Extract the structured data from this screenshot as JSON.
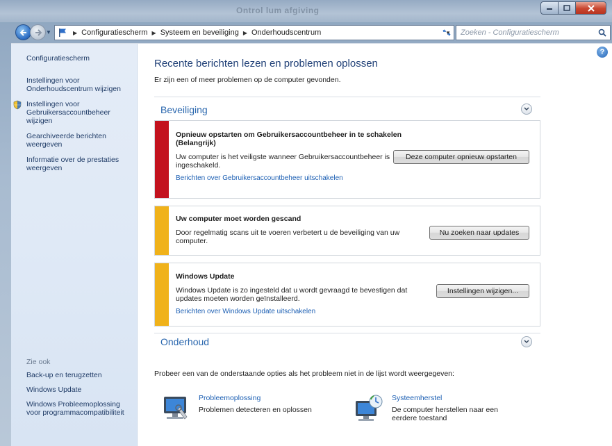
{
  "window": {
    "title": "Ontrol lum afgiving"
  },
  "nav": {
    "breadcrumb": [
      "Configuratiescherm",
      "Systeem en beveiliging",
      "Onderhoudscentrum"
    ],
    "search_placeholder": "Zoeken - Configuratiescherm"
  },
  "sidebar": {
    "home": "Configuratiescherm",
    "links": [
      "Instellingen voor Onderhoudscentrum wijzigen",
      "Instellingen voor Gebruikersaccountbeheer wijzigen",
      "Gearchiveerde berichten weergeven",
      "Informatie over de prestaties weergeven"
    ],
    "see_also_label": "Zie ook",
    "see_also": [
      "Back-up en terugzetten",
      "Windows Update",
      "Windows Probleemoplossing voor programmacompatibiliteit"
    ]
  },
  "main": {
    "heading": "Recente berichten lezen en problemen oplossen",
    "subheading": "Er zijn een of meer problemen op de computer gevonden.",
    "security": {
      "title": "Beveiliging",
      "messages": [
        {
          "title": "Opnieuw opstarten om Gebruikersaccountbeheer in te schakelen",
          "severity": "(Belangrijk)",
          "body": "Uw computer is het veiligste wanneer Gebruikersaccountbeheer is ingeschakeld.",
          "link": "Berichten over Gebruikersaccountbeheer uitschakelen",
          "button": "Deze computer opnieuw opstarten",
          "color": "#c3121e"
        },
        {
          "title": "Uw computer moet worden gescand",
          "body": "Door regelmatig scans uit te voeren verbetert u de beveiliging van uw computer.",
          "button": "Nu zoeken naar updates",
          "color": "#f0b21a"
        },
        {
          "title": "Windows Update",
          "body": "Windows Update is zo ingesteld dat u wordt gevraagd te bevestigen dat updates moeten worden geïnstalleerd.",
          "link": "Berichten over Windows Update uitschakelen",
          "button": "Instellingen wijzigen...",
          "color": "#f0b21a"
        }
      ]
    },
    "maintenance": {
      "title": "Onderhoud",
      "prompt": "Probeer een van de onderstaande opties als het probleem niet in de lijst wordt weergegeven:",
      "tools": [
        {
          "label": "Probleemoplossing",
          "desc": "Problemen detecteren en oplossen",
          "icon": "troubleshoot-icon"
        },
        {
          "label": "Systeemherstel",
          "desc": "De computer herstellen naar een eerdere toestand",
          "icon": "system-restore-icon"
        }
      ]
    }
  }
}
